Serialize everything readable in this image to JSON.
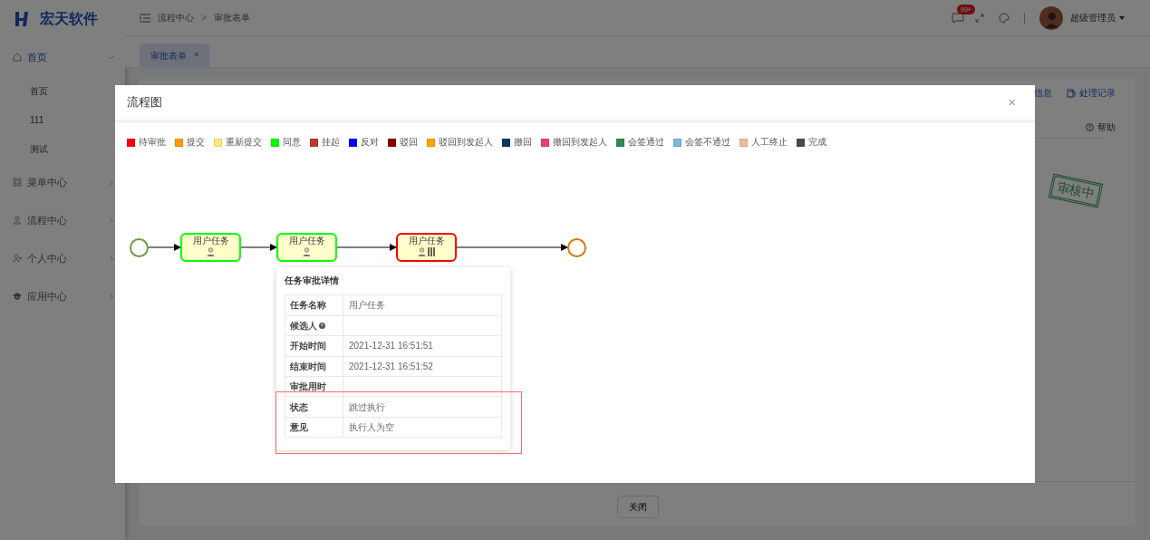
{
  "app": {
    "logo_text": "宏天软件"
  },
  "sidebar": {
    "items": [
      {
        "label": "首页",
        "expanded": true,
        "selected": true,
        "children": [
          {
            "label": "首页"
          },
          {
            "label": "111"
          },
          {
            "label": "测试"
          }
        ]
      },
      {
        "label": "菜单中心",
        "expanded": false,
        "selected": false
      },
      {
        "label": "流程中心",
        "expanded": false,
        "selected": false
      },
      {
        "label": "个人中心",
        "expanded": false,
        "selected": false
      },
      {
        "label": "应用中心",
        "expanded": false,
        "selected": false
      }
    ]
  },
  "header": {
    "breadcrumb": [
      "流程中心",
      "审批表单"
    ],
    "separator": ">",
    "message_badge": "99+",
    "user_name": "超级管理员"
  },
  "tabs": [
    {
      "label": "审批表单",
      "selected": true,
      "close": "×"
    }
  ],
  "background_page": {
    "links": [
      "信息",
      "处理记录"
    ],
    "help": "帮助",
    "stamp": "审核中",
    "close_button": "关闭"
  },
  "modal": {
    "title": "流程图",
    "close": "×",
    "legend": [
      {
        "label": "待审批",
        "color": "#ff0000"
      },
      {
        "label": "提交",
        "color": "#ff9900"
      },
      {
        "label": "重新提交",
        "color": "#ffe680"
      },
      {
        "label": "同意",
        "color": "#00ff00"
      },
      {
        "label": "挂起",
        "color": "#c0392b"
      },
      {
        "label": "反对",
        "color": "#0000ff"
      },
      {
        "label": "驳回",
        "color": "#8b0000"
      },
      {
        "label": "驳回到发起人",
        "color": "#ffa500"
      },
      {
        "label": "撤回",
        "color": "#0b3a5e"
      },
      {
        "label": "撤回到发起人",
        "color": "#f04070"
      },
      {
        "label": "会签通过",
        "color": "#2e8b57"
      },
      {
        "label": "会签不通过",
        "color": "#7eb6e0"
      },
      {
        "label": "人工终止",
        "color": "#f0b8a0"
      },
      {
        "label": "完成",
        "color": "#4a4a4a"
      }
    ],
    "diagram": {
      "nodes": [
        {
          "kind": "start",
          "color": "#6a9a4a"
        },
        {
          "kind": "task",
          "label": "用户任务",
          "color": "#00ff00",
          "multi_instance": false
        },
        {
          "kind": "task",
          "label": "用户任务",
          "color": "#00ff00",
          "multi_instance": false
        },
        {
          "kind": "task",
          "label": "用户任务",
          "color": "#ff0000",
          "multi_instance": true
        },
        {
          "kind": "end",
          "color": "#d2790e"
        }
      ]
    },
    "popover": {
      "title": "任务审批详情",
      "rows": [
        {
          "label": "任务名称",
          "value": "用户任务"
        },
        {
          "label": "候选人",
          "help": true
        },
        {
          "label": "开始时间",
          "value": "2021-12-31 16:51:51"
        },
        {
          "label": "结束时间",
          "value": "2021-12-31 16:51:52"
        },
        {
          "label": "审批用时"
        },
        {
          "label": "状态",
          "value": "跳过执行"
        },
        {
          "label": "意见",
          "value": "执行人为空"
        }
      ]
    }
  }
}
